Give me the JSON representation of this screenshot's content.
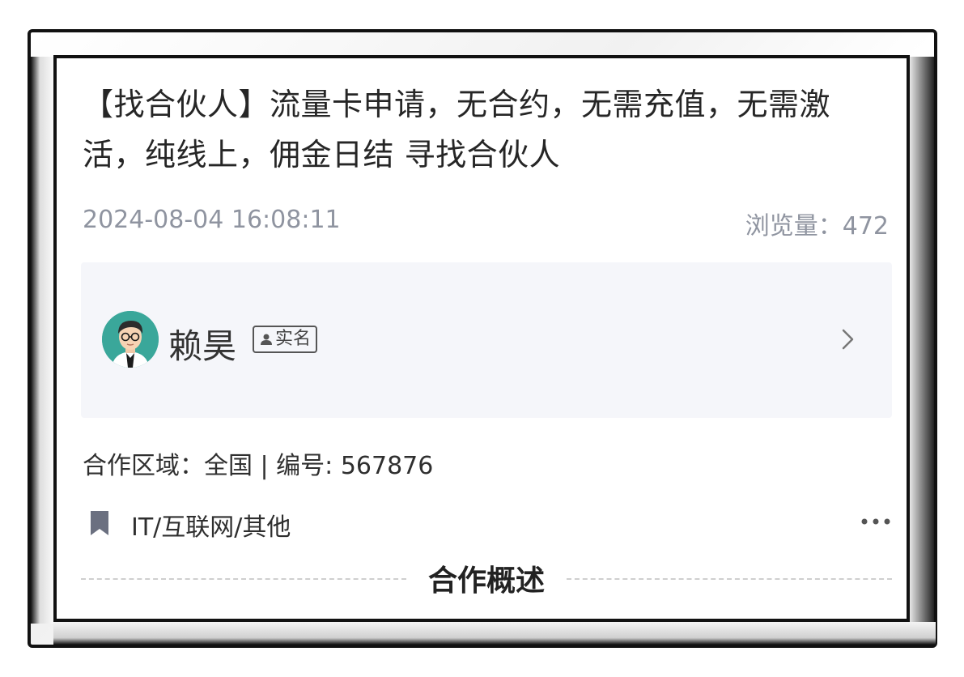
{
  "post": {
    "title": "【找合伙人】流量卡申请，无合约，无需充值，无需激活，纯线上，佣金日结 寻找合伙人",
    "date": "2024-08-04 16:08:11",
    "views_label": "浏览量：",
    "views": "472"
  },
  "author": {
    "name": "赖昊",
    "badge": "实名",
    "avatar_icon": "avatar-icon",
    "chevron_icon": "chevron-right-icon"
  },
  "details": {
    "info": "合作区域：全国 | 编号: 567876",
    "category": "IT/互联网/其他",
    "category_icon": "bookmark-icon",
    "more_icon": "more-icon"
  },
  "section": {
    "title": "合作概述"
  },
  "colors": {
    "meta_gray": "#8f94a0",
    "author_bg": "#f5f6fa",
    "avatar_teal": "#3aa79a",
    "frame": "#111111"
  }
}
